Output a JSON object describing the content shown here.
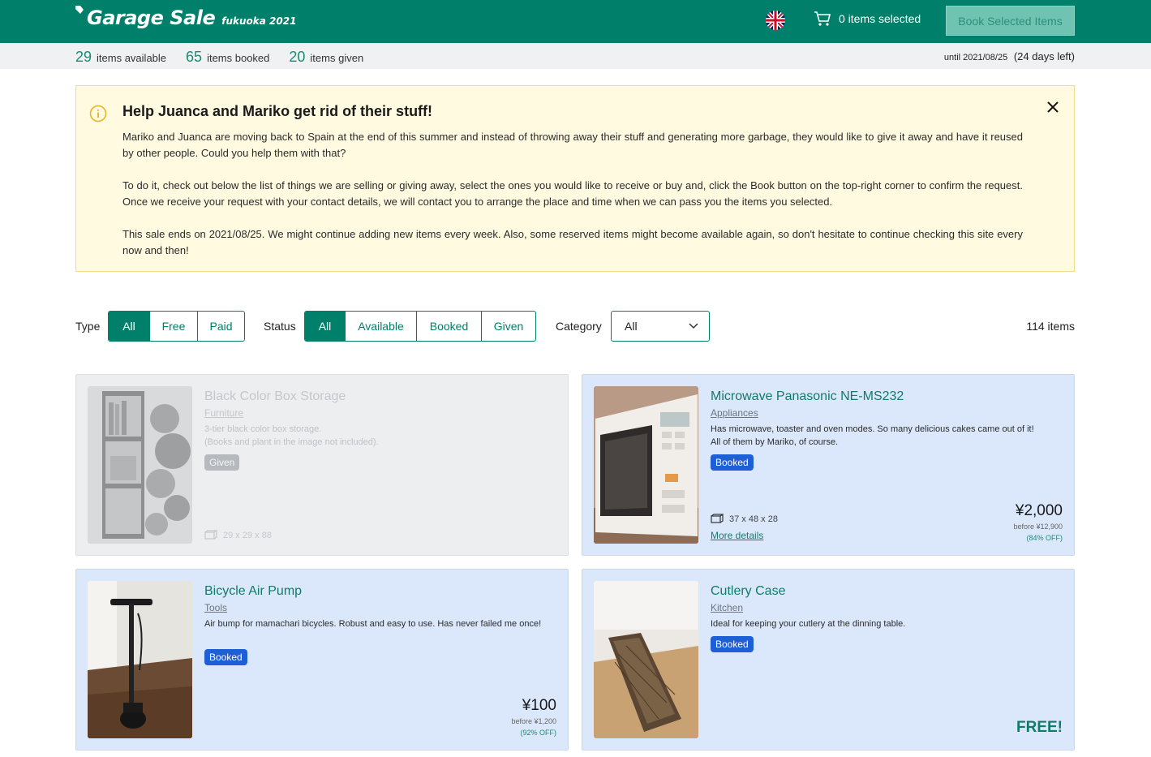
{
  "header": {
    "title": "Garage Sale",
    "subtitle": "fukuoka 2021",
    "cart_label": "0 items selected",
    "book_button": "Book Selected Items",
    "brand_color": "#00806a"
  },
  "stats": {
    "available_count": "29",
    "available_label": "items available",
    "booked_count": "65",
    "booked_label": "items booked",
    "given_count": "20",
    "given_label": "items given",
    "until_label": "until 2021/08/25",
    "days_left": "(24 days left)"
  },
  "alert": {
    "title": "Help Juanca and Mariko get rid of their stuff!",
    "p1": "Mariko and Juanca are moving back to Spain at the end of this summer and instead of throwing away their stuff and generating more garbage, they would like to give it away and have it reused by other people. Could you help them with that?",
    "p2": "To do it, check out below the list of things we are selling or giving away, select the ones you would like to receive or buy and, click the Book button on the top-right corner to confirm the request. Once we receive your request with your contact details, we will contact you to arrange the place and time when we can pass you the items you selected.",
    "p3": "This sale ends on 2021/08/25. We might continue adding new items every week. Also, some reserved items might become available again, so don't hesitate to continue checking this site every now and then!"
  },
  "filters": {
    "type_label": "Type",
    "type_options": [
      "All",
      "Free",
      "Paid"
    ],
    "status_label": "Status",
    "status_options": [
      "All",
      "Available",
      "Booked",
      "Given"
    ],
    "category_label": "Category",
    "category_value": "All",
    "items_count": "114 items"
  },
  "items": [
    {
      "title": "Black Color Box Storage",
      "category": "Furniture",
      "desc1": "3-tier black color box storage.",
      "desc2": "(Books and plant in the image not included).",
      "status": "Given",
      "dims": "29 x 29 x 88"
    },
    {
      "title": "Microwave Panasonic NE-MS232",
      "category": "Appliances",
      "desc1": "Has microwave, toaster and oven modes. So many delicious cakes came out of it!",
      "desc2": "All of them by Mariko, of course.",
      "status": "Booked",
      "dims": "37 x 48 x 28",
      "more": "More details",
      "price": "¥2,000",
      "before": "before ¥12,900",
      "off": "(84% OFF)"
    },
    {
      "title": "Bicycle Air Pump",
      "category": "Tools",
      "desc1": "Air bump for mamachari bicycles. Robust and easy to use. Has never failed me once!",
      "status": "Booked",
      "price": "¥100",
      "before": "before ¥1,200",
      "off": "(92% OFF)"
    },
    {
      "title": "Cutlery Case",
      "category": "Kitchen",
      "desc1": "Ideal for keeping your cutlery at the dinning table.",
      "status": "Booked",
      "price": "FREE!"
    }
  ]
}
